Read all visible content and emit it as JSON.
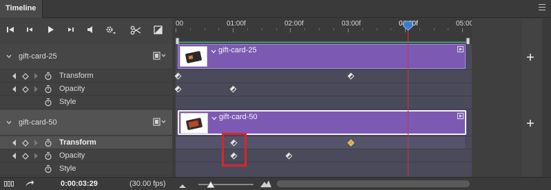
{
  "panel": {
    "tab_title": "Timeline",
    "menu_icon": "panel-menu-icon"
  },
  "toolbar": {
    "buttons": [
      "go-to-first-frame-icon",
      "previous-frame-icon",
      "play-icon",
      "next-frame-icon",
      "audio-icon",
      "settings-icon",
      "split-icon",
      "transition-icon"
    ]
  },
  "ruler": {
    "ticks": [
      "00",
      "01:00f",
      "02:00f",
      "03:00f",
      "04:00f",
      "05:00f"
    ],
    "playhead_label": "04:00f"
  },
  "layers": [
    {
      "name": "gift-card-25",
      "clip_label": "gift-card-25",
      "properties": [
        {
          "label": "Transform",
          "bold": false
        },
        {
          "label": "Opacity",
          "bold": false
        },
        {
          "label": "Style",
          "bold": false
        }
      ]
    },
    {
      "name": "gift-card-50",
      "clip_label": "gift-card-50",
      "properties": [
        {
          "label": "Transform",
          "bold": true
        },
        {
          "label": "Opacity",
          "bold": false
        },
        {
          "label": "Style",
          "bold": false
        }
      ]
    }
  ],
  "status": {
    "timecode": "0:00:03:29",
    "fps": "(30.00 fps)"
  },
  "colors": {
    "clip": "#7c5ab3",
    "playhead": "#d0323a",
    "highlight_box": "#d9262b",
    "keyframe_selected": "#d9a93a"
  }
}
